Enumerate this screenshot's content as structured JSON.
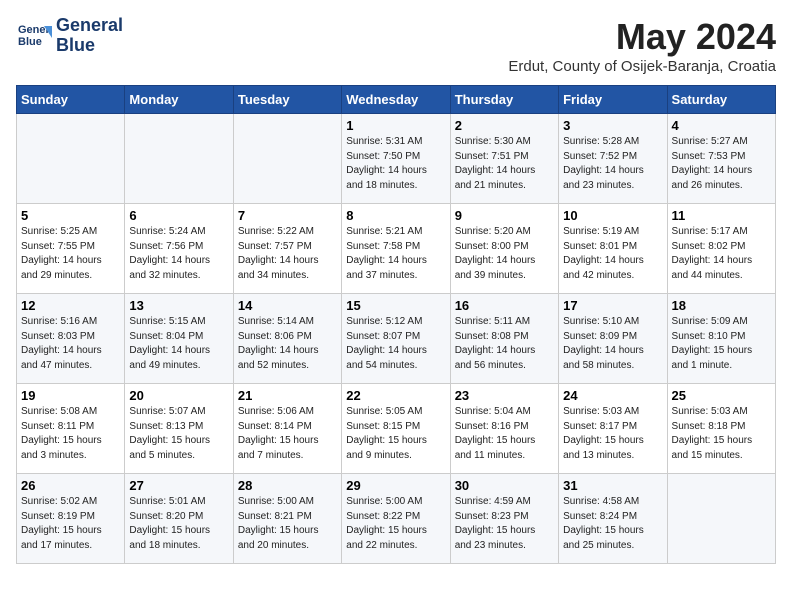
{
  "header": {
    "logo_line1": "General",
    "logo_line2": "Blue",
    "month": "May 2024",
    "location": "Erdut, County of Osijek-Baranja, Croatia"
  },
  "weekdays": [
    "Sunday",
    "Monday",
    "Tuesday",
    "Wednesday",
    "Thursday",
    "Friday",
    "Saturday"
  ],
  "weeks": [
    [
      {
        "day": "",
        "info": ""
      },
      {
        "day": "",
        "info": ""
      },
      {
        "day": "",
        "info": ""
      },
      {
        "day": "1",
        "info": "Sunrise: 5:31 AM\nSunset: 7:50 PM\nDaylight: 14 hours\nand 18 minutes."
      },
      {
        "day": "2",
        "info": "Sunrise: 5:30 AM\nSunset: 7:51 PM\nDaylight: 14 hours\nand 21 minutes."
      },
      {
        "day": "3",
        "info": "Sunrise: 5:28 AM\nSunset: 7:52 PM\nDaylight: 14 hours\nand 23 minutes."
      },
      {
        "day": "4",
        "info": "Sunrise: 5:27 AM\nSunset: 7:53 PM\nDaylight: 14 hours\nand 26 minutes."
      }
    ],
    [
      {
        "day": "5",
        "info": "Sunrise: 5:25 AM\nSunset: 7:55 PM\nDaylight: 14 hours\nand 29 minutes."
      },
      {
        "day": "6",
        "info": "Sunrise: 5:24 AM\nSunset: 7:56 PM\nDaylight: 14 hours\nand 32 minutes."
      },
      {
        "day": "7",
        "info": "Sunrise: 5:22 AM\nSunset: 7:57 PM\nDaylight: 14 hours\nand 34 minutes."
      },
      {
        "day": "8",
        "info": "Sunrise: 5:21 AM\nSunset: 7:58 PM\nDaylight: 14 hours\nand 37 minutes."
      },
      {
        "day": "9",
        "info": "Sunrise: 5:20 AM\nSunset: 8:00 PM\nDaylight: 14 hours\nand 39 minutes."
      },
      {
        "day": "10",
        "info": "Sunrise: 5:19 AM\nSunset: 8:01 PM\nDaylight: 14 hours\nand 42 minutes."
      },
      {
        "day": "11",
        "info": "Sunrise: 5:17 AM\nSunset: 8:02 PM\nDaylight: 14 hours\nand 44 minutes."
      }
    ],
    [
      {
        "day": "12",
        "info": "Sunrise: 5:16 AM\nSunset: 8:03 PM\nDaylight: 14 hours\nand 47 minutes."
      },
      {
        "day": "13",
        "info": "Sunrise: 5:15 AM\nSunset: 8:04 PM\nDaylight: 14 hours\nand 49 minutes."
      },
      {
        "day": "14",
        "info": "Sunrise: 5:14 AM\nSunset: 8:06 PM\nDaylight: 14 hours\nand 52 minutes."
      },
      {
        "day": "15",
        "info": "Sunrise: 5:12 AM\nSunset: 8:07 PM\nDaylight: 14 hours\nand 54 minutes."
      },
      {
        "day": "16",
        "info": "Sunrise: 5:11 AM\nSunset: 8:08 PM\nDaylight: 14 hours\nand 56 minutes."
      },
      {
        "day": "17",
        "info": "Sunrise: 5:10 AM\nSunset: 8:09 PM\nDaylight: 14 hours\nand 58 minutes."
      },
      {
        "day": "18",
        "info": "Sunrise: 5:09 AM\nSunset: 8:10 PM\nDaylight: 15 hours\nand 1 minute."
      }
    ],
    [
      {
        "day": "19",
        "info": "Sunrise: 5:08 AM\nSunset: 8:11 PM\nDaylight: 15 hours\nand 3 minutes."
      },
      {
        "day": "20",
        "info": "Sunrise: 5:07 AM\nSunset: 8:13 PM\nDaylight: 15 hours\nand 5 minutes."
      },
      {
        "day": "21",
        "info": "Sunrise: 5:06 AM\nSunset: 8:14 PM\nDaylight: 15 hours\nand 7 minutes."
      },
      {
        "day": "22",
        "info": "Sunrise: 5:05 AM\nSunset: 8:15 PM\nDaylight: 15 hours\nand 9 minutes."
      },
      {
        "day": "23",
        "info": "Sunrise: 5:04 AM\nSunset: 8:16 PM\nDaylight: 15 hours\nand 11 minutes."
      },
      {
        "day": "24",
        "info": "Sunrise: 5:03 AM\nSunset: 8:17 PM\nDaylight: 15 hours\nand 13 minutes."
      },
      {
        "day": "25",
        "info": "Sunrise: 5:03 AM\nSunset: 8:18 PM\nDaylight: 15 hours\nand 15 minutes."
      }
    ],
    [
      {
        "day": "26",
        "info": "Sunrise: 5:02 AM\nSunset: 8:19 PM\nDaylight: 15 hours\nand 17 minutes."
      },
      {
        "day": "27",
        "info": "Sunrise: 5:01 AM\nSunset: 8:20 PM\nDaylight: 15 hours\nand 18 minutes."
      },
      {
        "day": "28",
        "info": "Sunrise: 5:00 AM\nSunset: 8:21 PM\nDaylight: 15 hours\nand 20 minutes."
      },
      {
        "day": "29",
        "info": "Sunrise: 5:00 AM\nSunset: 8:22 PM\nDaylight: 15 hours\nand 22 minutes."
      },
      {
        "day": "30",
        "info": "Sunrise: 4:59 AM\nSunset: 8:23 PM\nDaylight: 15 hours\nand 23 minutes."
      },
      {
        "day": "31",
        "info": "Sunrise: 4:58 AM\nSunset: 8:24 PM\nDaylight: 15 hours\nand 25 minutes."
      },
      {
        "day": "",
        "info": ""
      }
    ]
  ]
}
